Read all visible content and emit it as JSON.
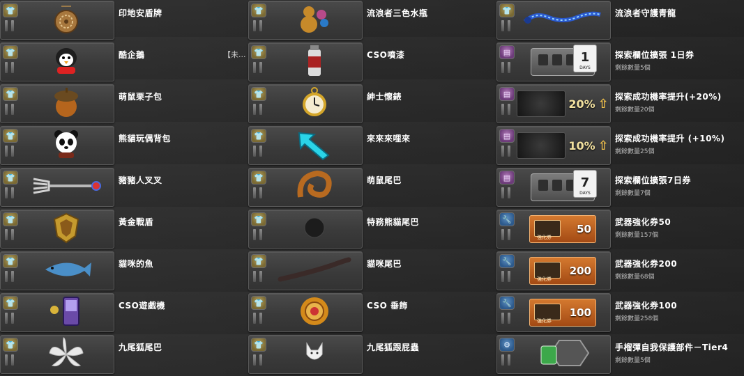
{
  "columns": [
    {
      "items": [
        {
          "badge": "shirt-icon",
          "icon": "dreamcatcher-shield-icon",
          "name": "印地安盾牌"
        },
        {
          "badge": "shirt-icon",
          "icon": "penguin-icon",
          "name": "酷企鵝",
          "extra": "【未..."
        },
        {
          "badge": "shirt-icon",
          "icon": "acorn-pack-icon",
          "name": "萌鼠栗子包"
        },
        {
          "badge": "shirt-icon",
          "icon": "panda-backpack-icon",
          "name": "熊貓玩偶背包"
        },
        {
          "badge": "shirt-icon",
          "icon": "fork-icon",
          "name": "豬豬人叉叉"
        },
        {
          "badge": "shirt-icon",
          "icon": "golden-shield-icon",
          "name": "黃金戰盾"
        },
        {
          "badge": "shirt-icon",
          "icon": "fish-icon",
          "name": "貓咪的魚"
        },
        {
          "badge": "shirt-icon",
          "icon": "handheld-console-icon",
          "name": "CSO遊戲機"
        },
        {
          "badge": "shirt-icon",
          "icon": "fox-tails-icon",
          "name": "九尾狐尾巴"
        }
      ]
    },
    {
      "items": [
        {
          "badge": "shirt-icon",
          "icon": "gourd-bottle-icon",
          "name": "流浪者三色水瓶"
        },
        {
          "badge": "shirt-icon",
          "icon": "spray-can-icon",
          "name": "CSO噴漆"
        },
        {
          "badge": "shirt-icon",
          "icon": "pocket-watch-icon",
          "name": "紳士懷錶"
        },
        {
          "badge": "shirt-icon",
          "icon": "cyan-arrow-icon",
          "name": "來來來哩來"
        },
        {
          "badge": "shirt-icon",
          "icon": "squirrel-tail-icon",
          "name": "萌鼠尾巴"
        },
        {
          "badge": "shirt-icon",
          "icon": "black-ball-tail-icon",
          "name": "特務熊貓尾巴"
        },
        {
          "badge": "shirt-icon",
          "icon": "cat-tail-icon",
          "name": "貓咪尾巴"
        },
        {
          "badge": "shirt-icon",
          "icon": "sun-ornament-icon",
          "name": "CSO 垂飾"
        },
        {
          "badge": "shirt-icon",
          "icon": "white-fox-icon",
          "name": "九尾狐跟屁蟲"
        }
      ]
    },
    {
      "items": [
        {
          "badge": "shirt-icon",
          "icon": "blue-dragon-icon",
          "name": "流浪者守護青龍"
        },
        {
          "badge": "ticket-icon",
          "icon": "slot-expand-1day-icon",
          "name": "探索欄位擴張 1日券",
          "sub": "剩餘數量5個",
          "calendar_day": "1",
          "calendar_label": "DAYS"
        },
        {
          "badge": "ticket-icon",
          "icon": "success-rate-20-icon",
          "name": "探索成功機率提升(+20%)",
          "sub": "剩餘數量20個",
          "rate": "20%"
        },
        {
          "badge": "ticket-icon",
          "icon": "success-rate-10-icon",
          "name": "探索成功機率提升 (+10%)",
          "sub": "剩餘數量25個",
          "rate": "10%"
        },
        {
          "badge": "ticket-icon",
          "icon": "slot-expand-7day-icon",
          "name": "探索欄位擴張7日券",
          "sub": "剩餘數量7個",
          "calendar_day": "7",
          "calendar_label": "DAYS"
        },
        {
          "badge": "wrench-icon",
          "icon": "enhance-voucher-50-icon",
          "name": "武器強化券50",
          "sub": "剩餘數量157個",
          "voucher": "50",
          "voucher_label": "強化券"
        },
        {
          "badge": "wrench-icon",
          "icon": "enhance-voucher-200-icon",
          "name": "武器強化券200",
          "sub": "剩餘數量68個",
          "voucher": "200",
          "voucher_label": "強化券"
        },
        {
          "badge": "wrench-icon",
          "icon": "enhance-voucher-100-icon",
          "name": "武器強化券100",
          "sub": "剩餘數量258個",
          "voucher": "100",
          "voucher_label": "強化券"
        },
        {
          "badge": "gear-icon",
          "icon": "grenade-part-icon",
          "name": "手榴彈自我保護部件－Tier4",
          "sub": "剩餘數量5個"
        }
      ]
    }
  ]
}
